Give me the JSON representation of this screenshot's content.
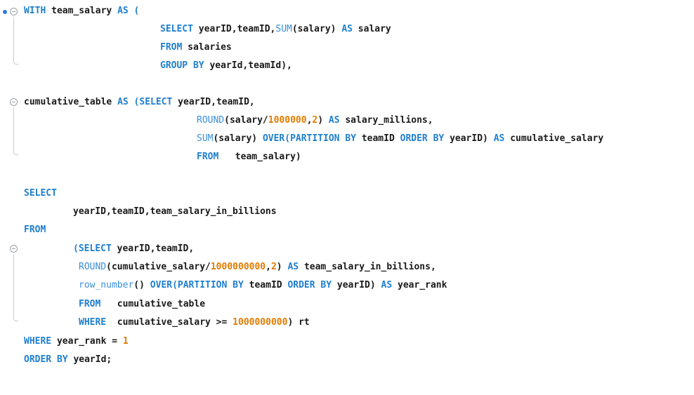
{
  "code": {
    "l1": [
      "WITH",
      "team_salary",
      "AS",
      "("
    ],
    "l2": [
      "SELECT",
      "yearID,teamID,",
      "SUM",
      "(salary)",
      "AS",
      "salary"
    ],
    "l3": [
      "FROM",
      "salaries"
    ],
    "l4": [
      "GROUP BY",
      "yearId,teamId),"
    ],
    "l5": [
      "cumulative_table",
      "AS",
      "(SELECT",
      "yearID,teamID,"
    ],
    "l6": [
      "ROUND",
      "(salary/",
      "1000000",
      ",",
      "2",
      ")",
      "AS",
      "salary_millions,"
    ],
    "l7": [
      "SUM",
      "(salary)",
      "OVER(PARTITION BY",
      "teamID",
      "ORDER BY",
      "yearID)",
      "AS",
      "cumulative_salary"
    ],
    "l8": [
      "FROM",
      "team_salary)"
    ],
    "l9": [
      "SELECT"
    ],
    "l10": [
      "yearID,teamID,team_salary_in_billions"
    ],
    "l11": [
      "FROM"
    ],
    "l12": [
      "(SELECT",
      "yearID,teamID,"
    ],
    "l13": [
      "ROUND",
      "(cumulative_salary/",
      "1000000000",
      ",",
      "2",
      ")",
      "AS",
      "team_salary_in_billions,"
    ],
    "l14": [
      "row_number",
      "()",
      "OVER(PARTITION BY",
      "teamID",
      "ORDER BY",
      "yearID)",
      "AS",
      "year_rank"
    ],
    "l15": [
      "FROM",
      "cumulative_table"
    ],
    "l16": [
      "WHERE",
      "cumulative_salary >=",
      "1000000000",
      ") rt"
    ],
    "l17": [
      "WHERE",
      "year_rank =",
      "1"
    ],
    "l18": [
      "ORDER BY",
      "yearId;"
    ]
  },
  "colors": {
    "keyword": "#1f7fcf",
    "function": "#3a8fd9",
    "number": "#e07b00",
    "text": "#1a1a1a"
  }
}
